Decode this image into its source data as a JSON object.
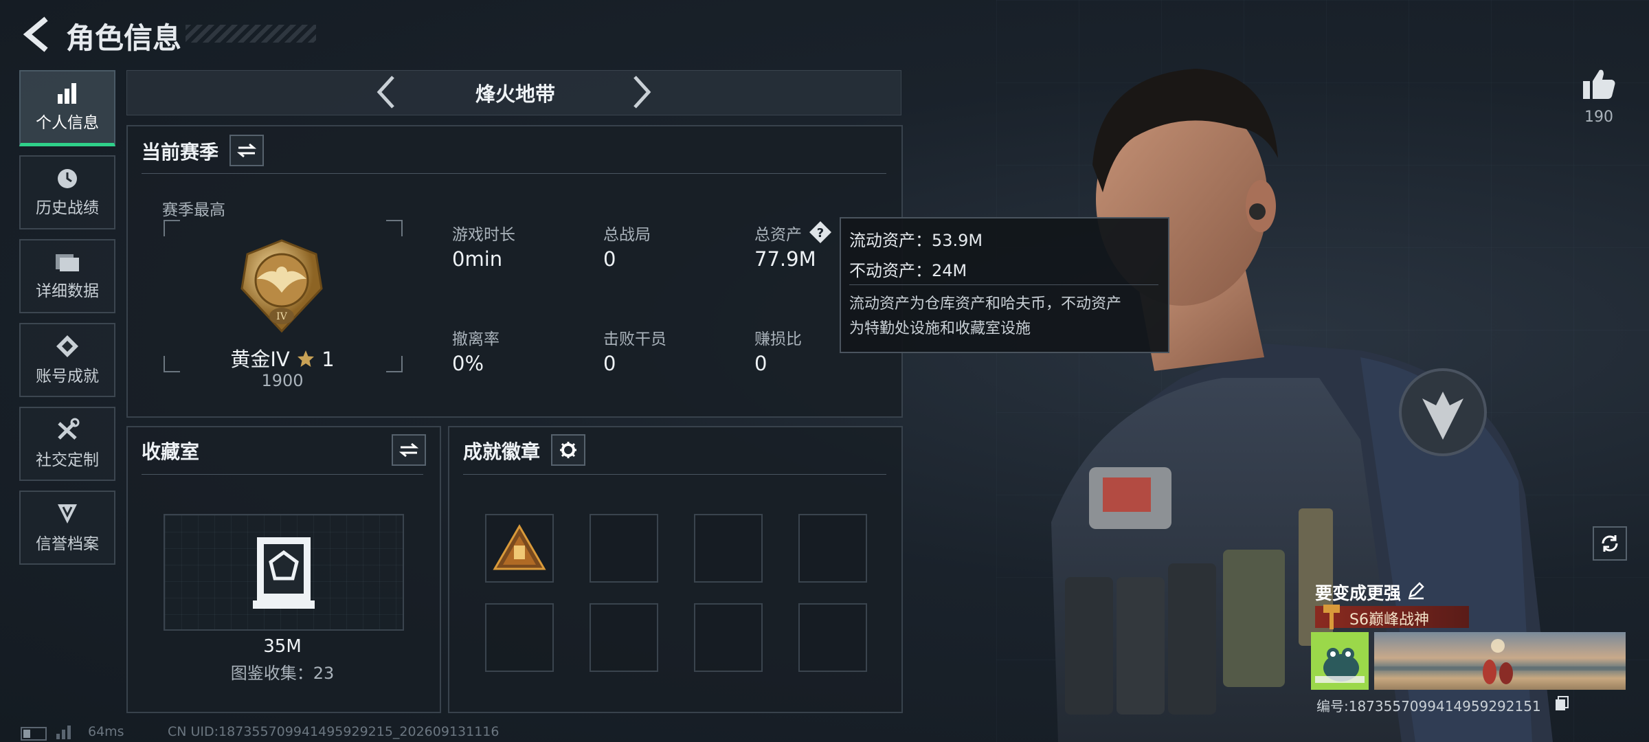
{
  "header": {
    "title": "角色信息"
  },
  "sidebar": {
    "items": [
      {
        "label": "个人信息",
        "icon": "bar-chart-icon"
      },
      {
        "label": "历史战绩",
        "icon": "clock-icon"
      },
      {
        "label": "详细数据",
        "icon": "folder-icon"
      },
      {
        "label": "账号成就",
        "icon": "achievement-icon"
      },
      {
        "label": "社交定制",
        "icon": "tools-icon"
      },
      {
        "label": "信誉档案",
        "icon": "shield-icon"
      }
    ]
  },
  "mode_selector": {
    "label": "烽火地带"
  },
  "season_panel": {
    "title": "当前赛季",
    "best_label": "赛季最高",
    "rank_name": "黄金IV",
    "rank_stars": "1",
    "rank_score": "1900",
    "rank_badge_numeral": "IV",
    "stats": [
      {
        "label": "游戏时长",
        "value": "0min"
      },
      {
        "label": "总战局",
        "value": "0"
      },
      {
        "label": "总资产",
        "value": "77.9M"
      },
      {
        "label": "撤离率",
        "value": "0%"
      },
      {
        "label": "击败干员",
        "value": "0"
      },
      {
        "label": "赚损比",
        "value": "0"
      }
    ]
  },
  "tooltip": {
    "liquid": "流动资产：53.9M",
    "fixed": "不动资产：24M",
    "desc_line1": "流动资产为仓库资产和哈夫币，不动资产",
    "desc_line2": "为特勤处设施和收藏室设施"
  },
  "collection_panel": {
    "title": "收藏室",
    "value": "35M",
    "count_text": "图鉴收集：23"
  },
  "badge_panel": {
    "title": "成就徽章"
  },
  "likes": {
    "count": "190"
  },
  "profile_card": {
    "title": "要变成更强",
    "season_title": "S6巅峰战神",
    "id_text": "编号:1873557099414959292151"
  },
  "footer": {
    "ping": "64ms",
    "uid_text": "CN UID:1873557099414959292​15_202609131116"
  },
  "colors": {
    "accent_green": "#2fd18a",
    "gold": "#c9a256",
    "season_tag": "#7a2a22"
  }
}
